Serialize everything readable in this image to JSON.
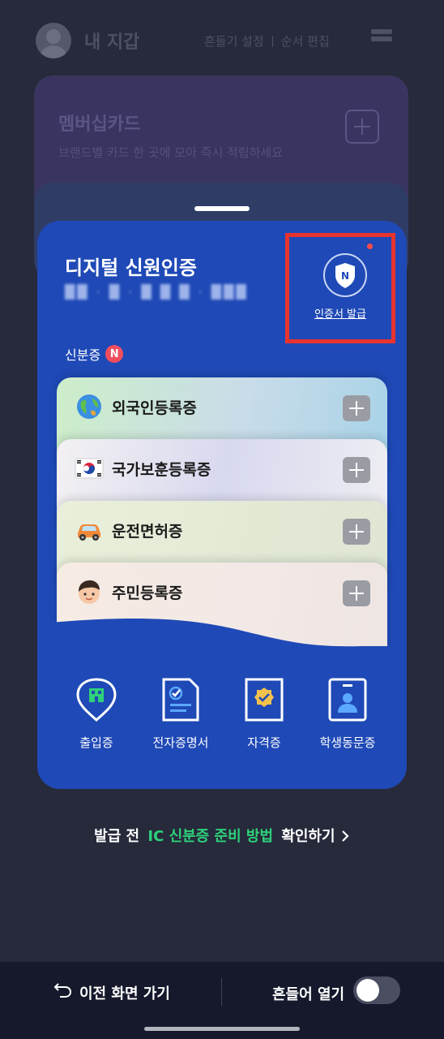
{
  "header": {
    "title": "내 지갑",
    "shake_settings": "흔들기 설정",
    "reorder": "순서 편집"
  },
  "background_cards": {
    "membership_title": "멤버십카드",
    "membership_subtitle": "브랜드별 카드 한 곳에 모아 즉시 적립하세요"
  },
  "digital_id": {
    "title": "디지털 신원인증",
    "masked_id": "██ · █ · █ █ █ · ███",
    "cert_issue_label": "인증서 발급",
    "cert_icon_letter": "N",
    "section_label": "신분증",
    "new_badge": "N",
    "cards": [
      {
        "name": "외국인등록증",
        "icon": "globe-icon"
      },
      {
        "name": "국가보훈등록증",
        "icon": "korean-flag-icon"
      },
      {
        "name": "운전면허증",
        "icon": "car-icon"
      },
      {
        "name": "주민등록증",
        "icon": "person-face-icon"
      }
    ],
    "shortcuts": [
      {
        "label": "출입증",
        "icon": "building-pin-icon"
      },
      {
        "label": "전자증명서",
        "icon": "document-check-icon"
      },
      {
        "label": "자격증",
        "icon": "certificate-badge-icon"
      },
      {
        "label": "학생동문증",
        "icon": "student-id-icon"
      }
    ]
  },
  "guide": {
    "prefix": "발급 전",
    "highlight": "IC 신분증 준비 방법",
    "suffix": "확인하기"
  },
  "bottom_bar": {
    "back_label": "이전 화면 가기",
    "shake_open_label": "흔들어 열기",
    "toggle_on": false
  },
  "colors": {
    "card_blue": "#1f49b6",
    "highlight_red": "#e8332f",
    "guide_green": "#2ed17a"
  }
}
